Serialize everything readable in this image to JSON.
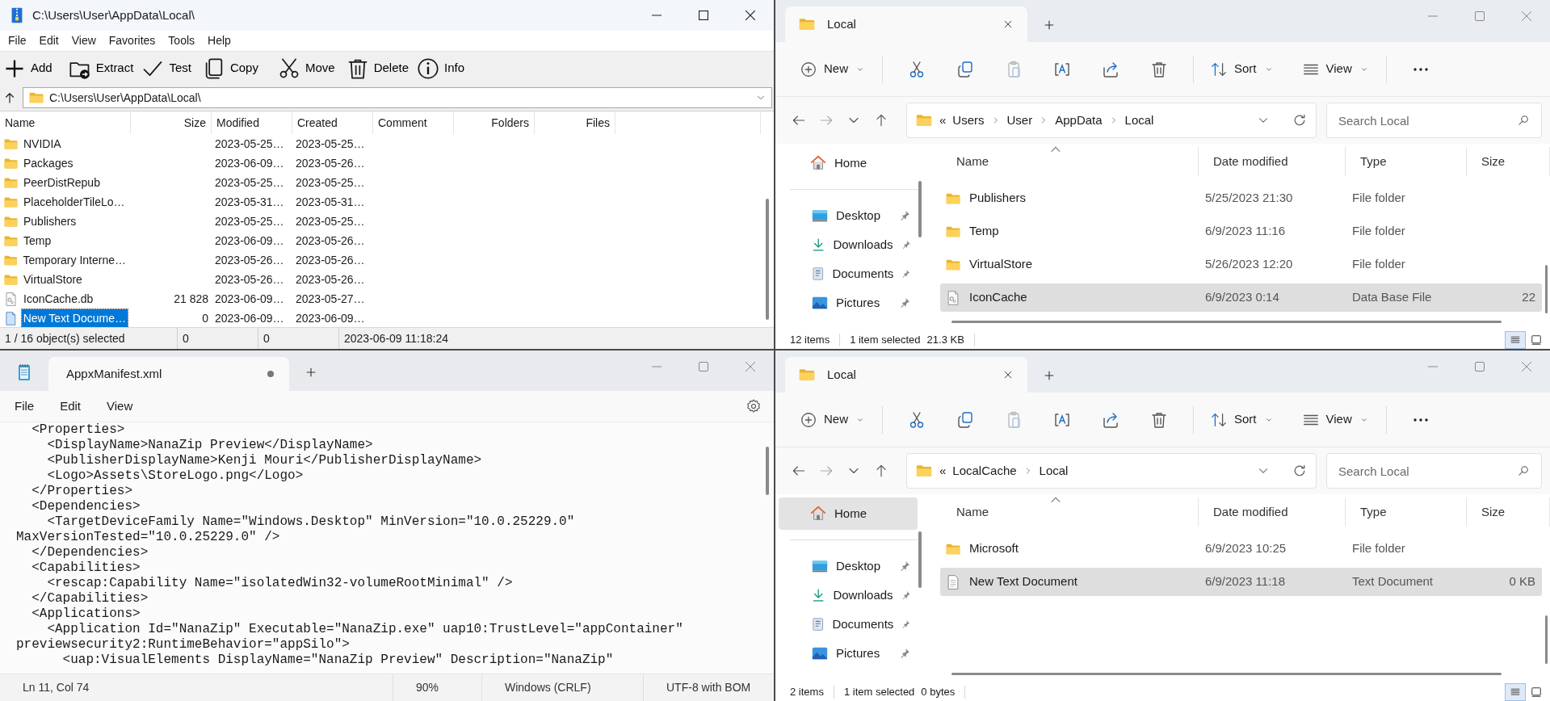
{
  "archive_window": {
    "title": "C:\\Users\\User\\AppData\\Local\\",
    "menu": [
      "File",
      "Edit",
      "View",
      "Favorites",
      "Tools",
      "Help"
    ],
    "toolbar": [
      "Add",
      "Extract",
      "Test",
      "Copy",
      "Move",
      "Delete",
      "Info"
    ],
    "path": "C:\\Users\\User\\AppData\\Local\\",
    "columns": [
      "Name",
      "Size",
      "Modified",
      "Created",
      "Comment",
      "Folders",
      "Files"
    ],
    "rows": [
      {
        "name": "NVIDIA",
        "kind": "folder",
        "modified": "2023-05-25…",
        "created": "2023-05-25…",
        "selected": false
      },
      {
        "name": "Packages",
        "kind": "folder",
        "modified": "2023-06-09…",
        "created": "2023-05-26…",
        "selected": false
      },
      {
        "name": "PeerDistRepub",
        "kind": "folder",
        "modified": "2023-05-25…",
        "created": "2023-05-25…",
        "selected": false
      },
      {
        "name": "PlaceholderTileLo…",
        "kind": "folder",
        "modified": "2023-05-31…",
        "created": "2023-05-31…",
        "selected": false
      },
      {
        "name": "Publishers",
        "kind": "folder",
        "modified": "2023-05-25…",
        "created": "2023-05-25…",
        "selected": false
      },
      {
        "name": "Temp",
        "kind": "folder",
        "modified": "2023-06-09…",
        "created": "2023-05-26…",
        "selected": false
      },
      {
        "name": "Temporary Interne…",
        "kind": "folder",
        "modified": "2023-05-26…",
        "created": "2023-05-26…",
        "selected": false
      },
      {
        "name": "VirtualStore",
        "kind": "folder",
        "modified": "2023-05-26…",
        "created": "2023-05-26…",
        "selected": false
      },
      {
        "name": "IconCache.db",
        "kind": "database",
        "size": "21 828",
        "modified": "2023-06-09…",
        "created": "2023-05-27…",
        "selected": false
      },
      {
        "name": "New Text Docume…",
        "kind": "document",
        "size": "0",
        "modified": "2023-06-09…",
        "created": "2023-06-09…",
        "selected": true
      }
    ],
    "status": [
      "1 / 16 object(s) selected",
      "0",
      "0",
      "2023-06-09 11:18:24"
    ]
  },
  "explorer_windows": [
    {
      "tab_title": "Local",
      "commands": [
        "New",
        "Sort",
        "View"
      ],
      "overflow_marker": "«",
      "breadcrumb": [
        "Users",
        "User",
        "AppData",
        "Local"
      ],
      "search": {
        "placeholder": "Search Local"
      },
      "nav": [
        {
          "label": "Home",
          "pinned": false,
          "selected": false
        },
        {
          "label": "Desktop",
          "pinned": true,
          "selected": false
        },
        {
          "label": "Downloads",
          "pinned": true,
          "selected": false
        },
        {
          "label": "Documents",
          "pinned": true,
          "selected": false
        },
        {
          "label": "Pictures",
          "pinned": true,
          "selected": false
        }
      ],
      "columns": [
        "Name",
        "Date modified",
        "Type",
        "Size"
      ],
      "rows": [
        {
          "name": "Publishers",
          "kind": "folder",
          "modified": "5/25/2023 21:30",
          "type": "File folder",
          "selected": false
        },
        {
          "name": "Temp",
          "kind": "folder",
          "modified": "6/9/2023 11:16",
          "type": "File folder",
          "selected": false
        },
        {
          "name": "VirtualStore",
          "kind": "folder",
          "modified": "5/26/2023 12:20",
          "type": "File folder",
          "selected": false
        },
        {
          "name": "IconCache",
          "kind": "database",
          "modified": "6/9/2023 0:14",
          "type": "Data Base File",
          "size": "22",
          "selected": true
        }
      ],
      "status": {
        "items": "12 items",
        "selection": "1 item selected",
        "size": "21.3 KB"
      }
    },
    {
      "tab_title": "Local",
      "commands": [
        "New",
        "Sort",
        "View"
      ],
      "overflow_marker": "«",
      "breadcrumb": [
        "LocalCache",
        "Local"
      ],
      "search": {
        "placeholder": "Search Local"
      },
      "nav": [
        {
          "label": "Home",
          "pinned": false,
          "selected": true
        },
        {
          "label": "Desktop",
          "pinned": true,
          "selected": false
        },
        {
          "label": "Downloads",
          "pinned": true,
          "selected": false
        },
        {
          "label": "Documents",
          "pinned": true,
          "selected": false
        },
        {
          "label": "Pictures",
          "pinned": true,
          "selected": false
        }
      ],
      "columns": [
        "Name",
        "Date modified",
        "Type",
        "Size"
      ],
      "rows": [
        {
          "name": "Microsoft",
          "kind": "folder",
          "modified": "6/9/2023 10:25",
          "type": "File folder",
          "selected": false
        },
        {
          "name": "New Text Document",
          "kind": "document",
          "modified": "6/9/2023 11:18",
          "type": "Text Document",
          "size": "0 KB",
          "selected": true
        }
      ],
      "status": {
        "items": "2 items",
        "selection": "1 item selected",
        "size": "0 bytes"
      }
    }
  ],
  "editor_window": {
    "tab": {
      "title": "AppxManifest.xml",
      "unsaved": true
    },
    "menu": [
      "File",
      "Edit",
      "View"
    ],
    "lines": [
      "  <Properties>",
      "    <DisplayName>NanaZip Preview</DisplayName>",
      "    <PublisherDisplayName>Kenji Mouri</PublisherDisplayName>",
      "    <Logo>Assets\\StoreLogo.png</Logo>",
      "  </Properties>",
      "  <Dependencies>",
      "    <TargetDeviceFamily Name=\"Windows.Desktop\" MinVersion=\"10.0.25229.0\"",
      "MaxVersionTested=\"10.0.25229.0\" />",
      "  </Dependencies>",
      "  <Capabilities>",
      "    <rescap:Capability Name=\"isolatedWin32-volumeRootMinimal\" />",
      "  </Capabilities>",
      "  <Applications>",
      "    <Application Id=\"NanaZip\" Executable=\"NanaZip.exe\" uap10:TrustLevel=\"appContainer\"",
      "previewsecurity2:RuntimeBehavior=\"appSilo\">",
      "      <uap:VisualElements DisplayName=\"NanaZip Preview\" Description=\"NanaZip\""
    ],
    "status": [
      "Ln 11, Col 74",
      "90%",
      "Windows (CRLF)",
      "UTF-8 with BOM"
    ]
  }
}
